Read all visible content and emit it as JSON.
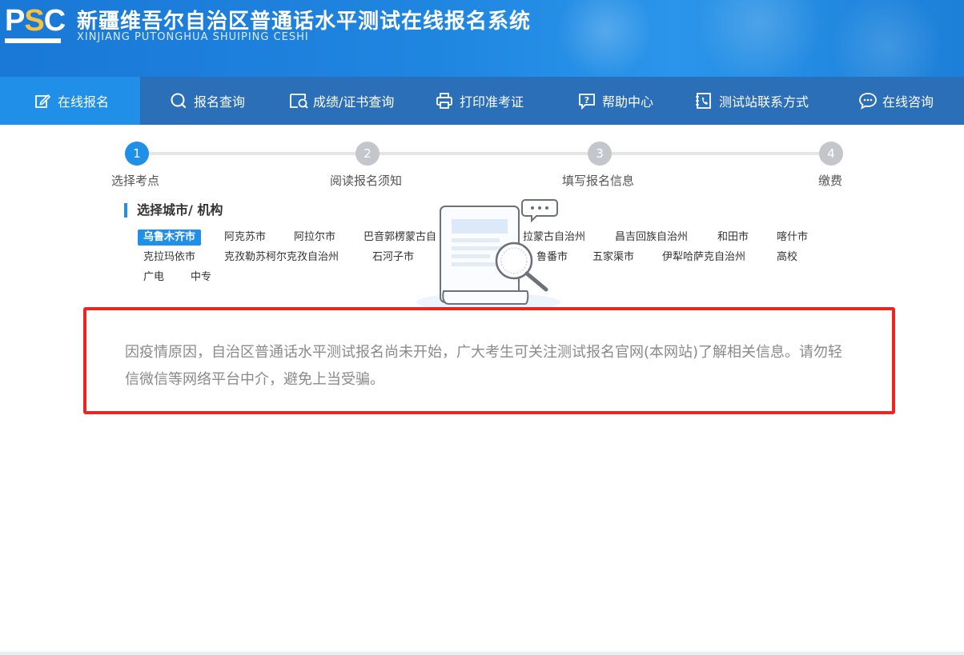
{
  "header": {
    "logo_text_p": "P",
    "logo_text_s": "S",
    "logo_text_c": "C",
    "title_cn": "新疆维吾尔自治区普通话水平测试在线报名系统",
    "title_en": "XINJIANG PUTONGHUA SHUIPING CESHI"
  },
  "nav": {
    "items": [
      {
        "label": "在线报名",
        "icon": "edit-icon",
        "active": true
      },
      {
        "label": "报名查询",
        "icon": "search-icon"
      },
      {
        "label": "成绩/证书查询",
        "icon": "certificate-search-icon"
      },
      {
        "label": "打印准考证",
        "icon": "printer-icon"
      },
      {
        "label": "帮助中心",
        "icon": "help-icon"
      },
      {
        "label": "测试站联系方式",
        "icon": "phone-book-icon"
      },
      {
        "label": "在线咨询",
        "icon": "chat-icon"
      }
    ]
  },
  "steps": [
    {
      "num": "1",
      "label": "选择考点",
      "state": "active"
    },
    {
      "num": "2",
      "label": "阅读报名须知",
      "state": "todo"
    },
    {
      "num": "3",
      "label": "填写报名信息",
      "state": "todo"
    },
    {
      "num": "4",
      "label": "缴费",
      "state": "todo"
    }
  ],
  "section_title": "选择城市/ 机构",
  "cities": {
    "row1": [
      "乌鲁木齐市",
      "阿克苏市",
      "阿拉尔市",
      "巴音郭楞蒙古自",
      "拉蒙古自治州",
      "昌吉回族自治州",
      "和田市",
      "喀什市"
    ],
    "row2": [
      "克拉玛依市",
      "克孜勒苏柯尔克孜自治州",
      "石河子市",
      "鲁番市",
      "五家渠市",
      "伊犁哈萨克自治州",
      "高校"
    ],
    "row3": [
      "广电",
      "中专"
    ]
  },
  "notice": {
    "text": "因疫情原因，自治区普通话水平测试报名尚未开始，广大考生可关注测试报名官网(本网站)了解相关信息。请勿轻信微信等网络平台中介，避免上当受骗。"
  },
  "colors": {
    "primary": "#1f8fe8",
    "nav_bg": "#2b6fb8",
    "notice_border": "#f0231e",
    "logo_accent": "#f5c242"
  }
}
